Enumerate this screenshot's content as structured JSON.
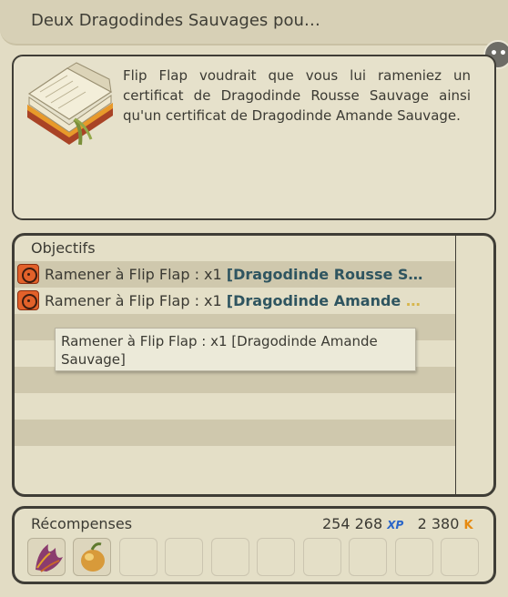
{
  "title": "Deux Dragodindes Sauvages pou…",
  "chat_icon": "speech-bubble-icon",
  "description": "Flip Flap voudrait que vous lui rameniez un certificat de Dragodinde Rousse Sauvage ainsi qu'un certificat de Dragodinde Amande Sauvage.",
  "objectives": {
    "header": "Objectifs",
    "items": [
      {
        "prefix": "Ramener à Flip Flap : x1 ",
        "item": "[Dragodinde Rousse S",
        "suffix": "…"
      },
      {
        "prefix": "Ramener à Flip Flap : x1 ",
        "item": "[Dragodinde Amande ",
        "suffix": "…"
      }
    ]
  },
  "tooltip": "Ramener à Flip Flap : x1 [Dragodinde Amande Sauvage]",
  "rewards": {
    "title": "Récompenses",
    "xp_value": "254 268",
    "xp_label": "XP",
    "kamas_value": "2 380",
    "kamas_label": "K"
  },
  "colors": {
    "accent_item": "#2f5560",
    "objective_icon": "#e2612a"
  }
}
